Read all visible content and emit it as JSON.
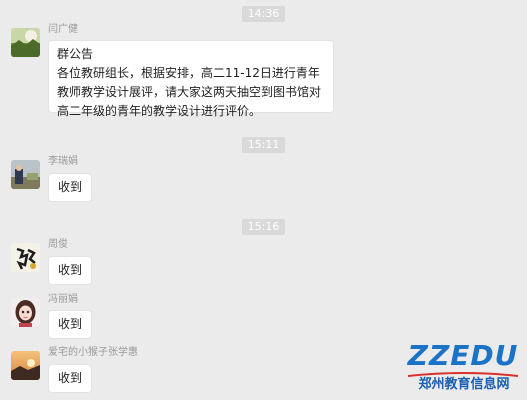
{
  "timestamps": [
    "14:36",
    "15:11",
    "15:16"
  ],
  "messages": [
    {
      "sender": "闫广健",
      "avatar_icon": "nature-photo-avatar",
      "title": "群公告",
      "body": "各位教研组长，根据安排，高二11-12日进行青年教师教学设计展评，请大家这两天抽空到图书馆对高二年级的青年的教学设计进行评价。"
    },
    {
      "sender": "李瑞娟",
      "avatar_icon": "outdoor-photo-avatar",
      "text": "收到"
    },
    {
      "sender": "周俊",
      "avatar_icon": "calligraphy-avatar",
      "text": "收到"
    },
    {
      "sender": "冯丽娟",
      "avatar_icon": "doll-avatar",
      "text": "收到"
    },
    {
      "sender": "爱宅的小猴子张学惠",
      "avatar_icon": "sunset-avatar",
      "text": "收到"
    }
  ],
  "watermark": {
    "brand": "ZZEDU",
    "site": "郑州教育信息网"
  },
  "colors": {
    "background": "#ebebeb",
    "bubble": "#ffffff",
    "timestamp_bg": "#d9d9d9",
    "logo_blue": "#1a73c7"
  }
}
